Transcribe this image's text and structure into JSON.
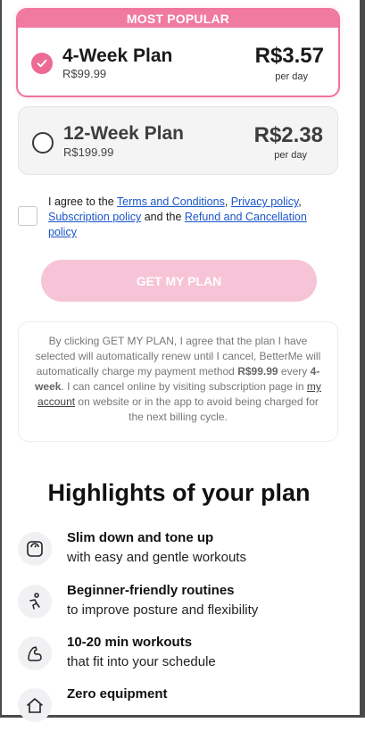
{
  "plans": {
    "popular": {
      "banner": "MOST POPULAR",
      "name": "4-Week Plan",
      "original_price": "R$99.99",
      "price": "R$3.57",
      "per": "per day",
      "selected": true
    },
    "regular": {
      "name": "12-Week Plan",
      "original_price": "R$199.99",
      "price": "R$2.38",
      "per": "per day",
      "selected": false
    }
  },
  "agreement": {
    "prefix": "I agree to the ",
    "terms": "Terms and Conditions",
    "sep1": ", ",
    "privacy": "Privacy policy",
    "sep2": ", ",
    "subscription": "Subscription policy",
    "and": " and the ",
    "refund": "Refund and Cancellation policy"
  },
  "cta": {
    "label": "GET MY PLAN"
  },
  "terms": {
    "part1": "By clicking GET MY PLAN, I agree that the plan I have selected will automatically renew until I cancel, BetterMe will automatically charge my payment method ",
    "price": "R$99.99",
    "part2": " every ",
    "period": "4-week",
    "part3": ". I can cancel online by visiting subscription page in ",
    "account_link": "my account",
    "part4": " on website or in the app to avoid being charged for the next billing cycle."
  },
  "highlights": {
    "title": "Highlights of your plan",
    "items": [
      {
        "icon": "scale-icon",
        "title": "Slim down and tone up",
        "subtitle": "with easy and gentle workouts"
      },
      {
        "icon": "stretch-icon",
        "title": "Beginner-friendly routines",
        "subtitle": "to improve posture and flexibility"
      },
      {
        "icon": "muscle-icon",
        "title": "10-20 min workouts",
        "subtitle": "that fit into your schedule"
      },
      {
        "icon": "home-icon",
        "title": "Zero equipment",
        "subtitle": ""
      }
    ]
  },
  "colors": {
    "accent_pink": "#f07aa0",
    "cta_disabled": "#f6c4d6",
    "link_blue": "#1a56c8"
  }
}
